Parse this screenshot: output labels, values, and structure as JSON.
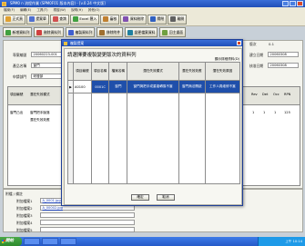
{
  "window": {
    "title": "SPM0 n 流程作業 (SPM0F01 版本內容) - [v.0.24 中文版]"
  },
  "menu": [
    "檔案(F)",
    "編輯(E)",
    "工具(T)",
    "視窗(W)",
    "說明(H)",
    "其他(O)"
  ],
  "toolbar": {
    "buttons": [
      {
        "label": "正式頁",
        "color": "#e0a030"
      },
      {
        "label": "提案單",
        "color": "#5070d0"
      },
      {
        "label": "查詢",
        "color": "#d05050"
      },
      {
        "label": "Excel 匯入",
        "color": "#40a040"
      },
      {
        "label": "審核",
        "color": "#c08030"
      },
      {
        "label": "資料刪除",
        "color": "#8050b0"
      },
      {
        "label": "關閉",
        "color": "#3060c0"
      },
      {
        "label": "離開",
        "color": "#606060"
      }
    ]
  },
  "subtoolbar": {
    "buttons": [
      {
        "label": "新增資料列"
      },
      {
        "label": "刪除資料列"
      },
      {
        "label": "複製資料列"
      },
      {
        "label": "移除附件"
      },
      {
        "label": "變更檔案資料"
      },
      {
        "label": "回主畫面"
      }
    ]
  },
  "form": {
    "doc_no_label": "專案編號",
    "doc_no_value": "20060223-001",
    "product_label": "產品名稱",
    "product_value": "窗門",
    "applicant_label": "申請部門",
    "applicant_value": "研發部",
    "version_label": "版次",
    "version_value": "0.1",
    "create_date_label": "建立日期",
    "create_date_value": "20060308",
    "approve_date_label": "核准日期",
    "approve_date_value": "20060308"
  },
  "grid": {
    "headers": [
      "項目編號",
      "潛在失效模式",
      "潛在失效效應",
      "Rev",
      "Det",
      "Occ",
      "RPN"
    ],
    "row_values": [
      "窗門凸出",
      "窗門把手脫落",
      "1",
      "1",
      "1",
      "1",
      "125"
    ]
  },
  "attachments": {
    "label": "附檔 / 備註",
    "rows": [
      {
        "label": "附加檔案1",
        "file": "A_0001.jpg"
      },
      {
        "label": "附加檔案2",
        "file": "A_00002.jpg"
      },
      {
        "label": "附加檔案3",
        "file": ""
      },
      {
        "label": "附加檔案4",
        "file": ""
      },
      {
        "label": "附加檔案5",
        "file": ""
      }
    ]
  },
  "modal": {
    "title": "複製提案",
    "heading": "請選擇要複製變更版次的資料列",
    "hint": "顯示詳細資料(D)",
    "columns": [
      "",
      "項目編號",
      "項目名稱",
      "檔案名稱",
      "潛在失效模式",
      "潛在失效效應",
      "潛在失效原因"
    ],
    "row": {
      "marker": "▶",
      "name": "A0100",
      "code": "0001C",
      "file": "窗門",
      "mode": "窗門與把手或重複轉換不當",
      "effect": "窗門無法開啟",
      "cause": "工作人員維修不當"
    },
    "ok_label": "確定",
    "cancel_label": "取消"
  },
  "taskbar": {
    "start_label": "開始",
    "clock": "上午 10:14"
  }
}
